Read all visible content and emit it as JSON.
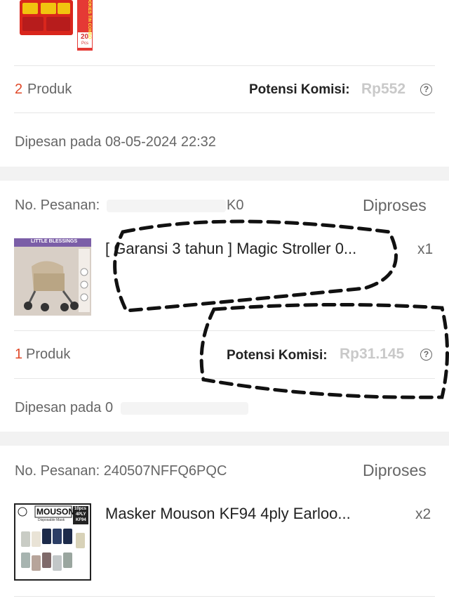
{
  "order1": {
    "product_count": "2",
    "product_label": "Produk",
    "komisi_label": "Potensi Komisi:",
    "komisi_value": "Rp552",
    "info_icon": "question-circle-icon",
    "ordered_at": "Dipesan pada 08-05-2024 22:32",
    "thumb": {
      "badge_top": "COOKIES TIN COMBO",
      "badge_bottom": "20",
      "badge_pcs": "Pcs"
    }
  },
  "order2": {
    "order_no_label": "No. Pesanan:",
    "order_no_visible_suffix": "K0",
    "status": "Diproses",
    "product_title": "[ Garansi 3 tahun ] Magic Stroller 0...",
    "quantity": "x1",
    "product_count": "1",
    "product_label": "Produk",
    "komisi_label": "Potensi Komisi:",
    "komisi_value": "Rp31.145",
    "info_icon": "question-circle-icon",
    "ordered_at_prefix": "Dipesan pada 0",
    "thumb": {
      "banner": "LITTLE BLESSINGS"
    }
  },
  "order3": {
    "order_no": "No. Pesanan: 240507NFFQ6PQC",
    "status": "Diproses",
    "product_title": "Masker Mouson KF94 4ply Earloo...",
    "quantity": "x2",
    "thumb": {
      "brand": "MOUSON",
      "badge_1": "10pcs",
      "badge_2": "4PLY",
      "badge_3": "KF94",
      "sub": "Disposable Mask"
    }
  },
  "colors": {
    "accent": "#e04a2a",
    "muted": "#666666",
    "divider": "#f2f2f2",
    "komisi_value": "#c9c9c9"
  }
}
